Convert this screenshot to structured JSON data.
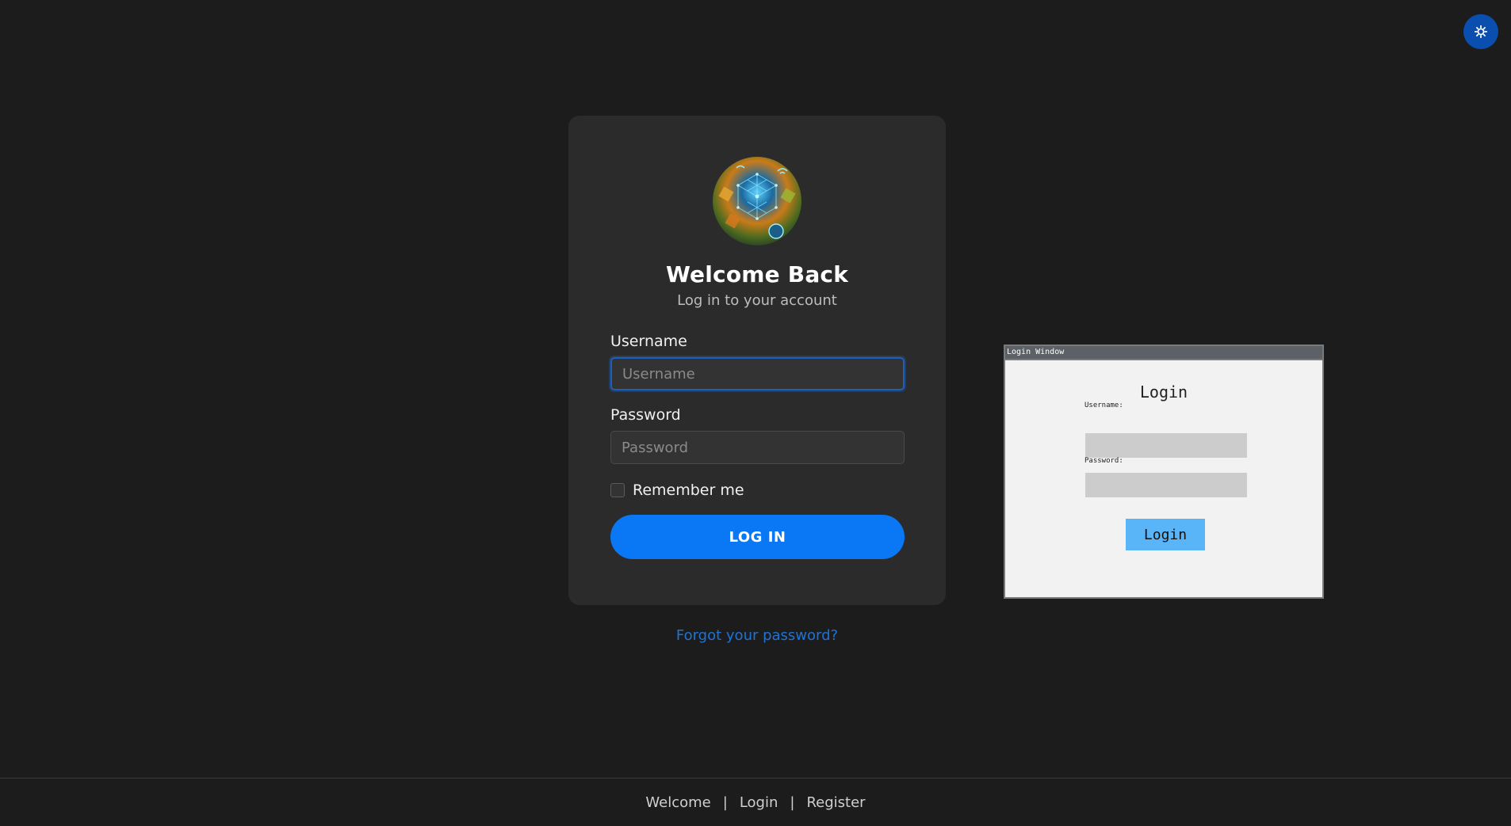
{
  "theme_toggle": {
    "icon": "sun-icon",
    "accent": "#0a4fb0"
  },
  "card": {
    "avatar_icon": "network-avatar",
    "title": "Welcome Back",
    "subtitle": "Log in to your account",
    "username_label": "Username",
    "username_placeholder": "Username",
    "username_value": "",
    "password_label": "Password",
    "password_placeholder": "Password",
    "password_value": "",
    "remember_label": "Remember me",
    "remember_checked": false,
    "login_button": "LOG IN",
    "accent": "#0a78f5"
  },
  "forgot_link": "Forgot your password?",
  "mini_window": {
    "title": "Login Window",
    "heading": "Login",
    "username_label": "Username:",
    "password_label": "Password:",
    "login_button": "Login",
    "button_color": "#5ab4f8"
  },
  "footer": {
    "links": [
      "Welcome",
      "Login",
      "Register"
    ],
    "separator": "|"
  }
}
